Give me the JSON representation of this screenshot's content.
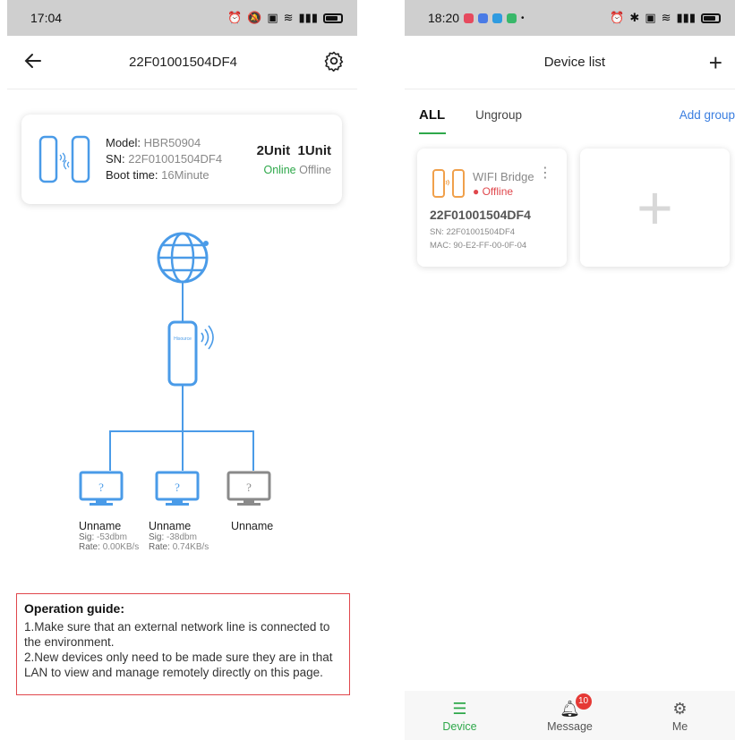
{
  "left": {
    "status_time": "17:04",
    "title": "22F01001504DF4",
    "card": {
      "model_label": "Model:",
      "model_value": "HBR50904",
      "sn_label": "SN:",
      "sn_value": "22F01001504DF4",
      "boot_label": "Boot time:",
      "boot_value": "16Minute",
      "units_a": "2Unit",
      "units_b": "1Unit",
      "online": "Online",
      "offline": "Offline"
    },
    "bridge_logo": "Hisource",
    "clients": [
      {
        "name": "Unname",
        "sig_label": "Sig:",
        "sig": "-53dbm",
        "rate_label": "Rate:",
        "rate": "0.00KB/s",
        "color": "#4a9be8"
      },
      {
        "name": "Unname",
        "sig_label": "Sig:",
        "sig": "-38dbm",
        "rate_label": "Rate:",
        "rate": "0.74KB/s",
        "color": "#4a9be8"
      },
      {
        "name": "Unname",
        "color": "#8a8a8a"
      }
    ],
    "guide": {
      "title": "Operation guide",
      "line1": "1.Make sure that an external network line is connected to the environment.",
      "line2": "2.New devices only need to be made sure they are in that LAN to view and manage remotely directly on this page."
    }
  },
  "right": {
    "status_time": "18:20",
    "title": "Device list",
    "tabs": {
      "all": "ALL",
      "ungroup": "Ungroup",
      "add_group": "Add group"
    },
    "device": {
      "name": "WIFI Bridge",
      "status": "Offline",
      "id": "22F01001504DF4",
      "sn": "SN: 22F01001504DF4",
      "mac": "MAC: 90-E2-FF-00-0F-04"
    },
    "nav": {
      "device": "Device",
      "message": "Message",
      "message_badge": "10",
      "me": "Me"
    }
  },
  "colors": {
    "green": "#2ea84a",
    "blue": "#3a7ee0",
    "red": "#e0474c",
    "orange": "#f0a04b"
  }
}
